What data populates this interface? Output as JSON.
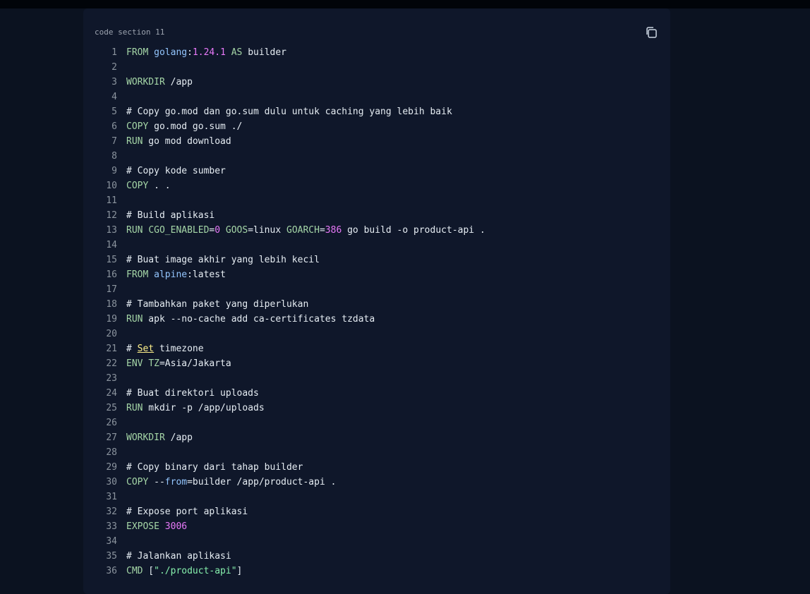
{
  "caption": "code section 11",
  "copy_icon": "copy-icon",
  "colors": {
    "keyword": "#a5d6a7",
    "image": "#93c5fd",
    "number": "#e879f9",
    "string": "#86efac",
    "text": "#e6edf3",
    "line_number": "#8b949e"
  },
  "lines": [
    [
      [
        "kw",
        "FROM"
      ],
      [
        "t",
        " "
      ],
      [
        "img",
        "golang"
      ],
      [
        "t",
        ":"
      ],
      [
        "num",
        "1.24.1"
      ],
      [
        "t",
        " "
      ],
      [
        "kw",
        "AS"
      ],
      [
        "t",
        " builder"
      ]
    ],
    [],
    [
      [
        "kw",
        "WORKDIR"
      ],
      [
        "t",
        " /app"
      ]
    ],
    [],
    [
      [
        "t",
        "# Copy go.mod dan go.sum dulu untuk caching yang lebih baik"
      ]
    ],
    [
      [
        "kw",
        "COPY"
      ],
      [
        "t",
        " go.mod go.sum ./"
      ]
    ],
    [
      [
        "kw",
        "RUN"
      ],
      [
        "t",
        " go mod download"
      ]
    ],
    [],
    [
      [
        "t",
        "# Copy kode sumber"
      ]
    ],
    [
      [
        "kw",
        "COPY"
      ],
      [
        "t",
        " . ."
      ]
    ],
    [],
    [
      [
        "t",
        "# Build aplikasi"
      ]
    ],
    [
      [
        "kw",
        "RUN"
      ],
      [
        "t",
        " "
      ],
      [
        "var",
        "CGO_ENABLED"
      ],
      [
        "t",
        "="
      ],
      [
        "num",
        "0"
      ],
      [
        "t",
        " "
      ],
      [
        "var",
        "GOOS"
      ],
      [
        "t",
        "=linux "
      ],
      [
        "var",
        "GOARCH"
      ],
      [
        "t",
        "="
      ],
      [
        "num",
        "386"
      ],
      [
        "t",
        " go build -o product-api ."
      ]
    ],
    [],
    [
      [
        "t",
        "# Buat image akhir yang lebih kecil"
      ]
    ],
    [
      [
        "kw",
        "FROM"
      ],
      [
        "t",
        " "
      ],
      [
        "img",
        "alpine"
      ],
      [
        "t",
        ":latest"
      ]
    ],
    [],
    [
      [
        "t",
        "# Tambahkan paket yang diperlukan"
      ]
    ],
    [
      [
        "kw",
        "RUN"
      ],
      [
        "t",
        " apk --no-cache add ca-certificates tzdata"
      ]
    ],
    [],
    [
      [
        "t",
        "# "
      ],
      [
        "under",
        "Set"
      ],
      [
        "t",
        " timezone"
      ]
    ],
    [
      [
        "kw",
        "ENV"
      ],
      [
        "t",
        " "
      ],
      [
        "var",
        "TZ"
      ],
      [
        "t",
        "=Asia/Jakarta"
      ]
    ],
    [],
    [
      [
        "t",
        "# Buat direktori uploads"
      ]
    ],
    [
      [
        "kw",
        "RUN"
      ],
      [
        "t",
        " mkdir -p /app/uploads"
      ]
    ],
    [],
    [
      [
        "kw",
        "WORKDIR"
      ],
      [
        "t",
        " /app"
      ]
    ],
    [],
    [
      [
        "t",
        "# Copy binary dari tahap builder"
      ]
    ],
    [
      [
        "kw",
        "COPY"
      ],
      [
        "t",
        " --"
      ],
      [
        "flag",
        "from"
      ],
      [
        "t",
        "=builder /app/product-api ."
      ]
    ],
    [],
    [
      [
        "t",
        "# Expose port aplikasi"
      ]
    ],
    [
      [
        "kw",
        "EXPOSE"
      ],
      [
        "t",
        " "
      ],
      [
        "num",
        "3006"
      ]
    ],
    [],
    [
      [
        "t",
        "# Jalankan aplikasi"
      ]
    ],
    [
      [
        "kw",
        "CMD"
      ],
      [
        "t",
        " ["
      ],
      [
        "str",
        "\"./product-api\""
      ],
      [
        "t",
        "]"
      ]
    ]
  ]
}
